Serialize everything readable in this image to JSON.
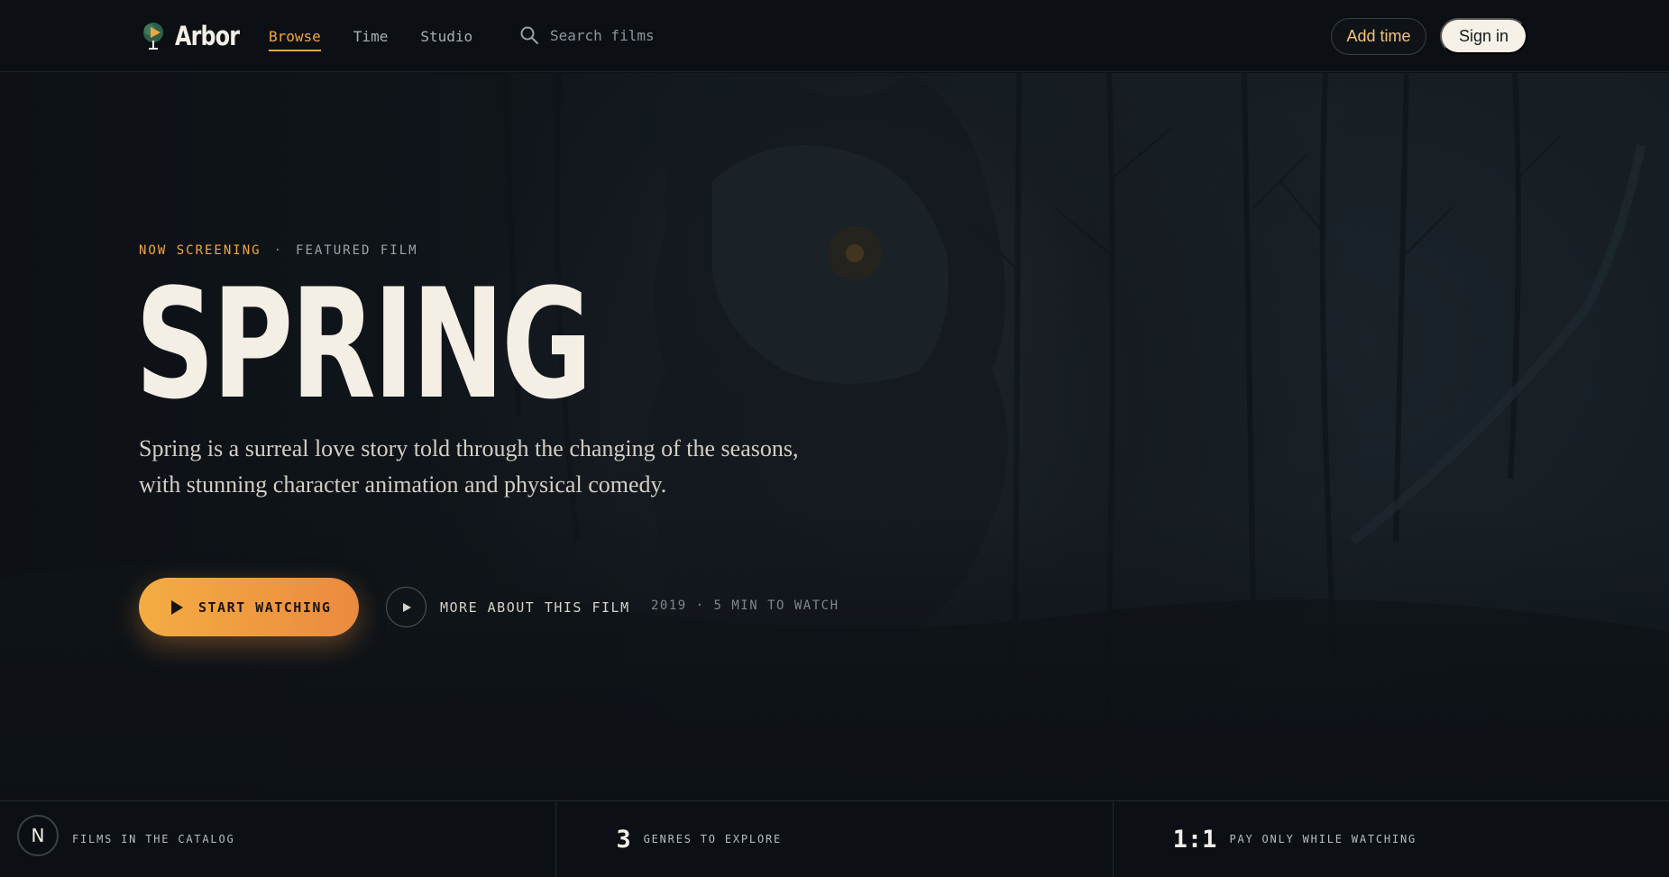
{
  "header": {
    "brand": "Arbor",
    "nav": [
      {
        "label": "Browse",
        "active": true
      },
      {
        "label": "Time",
        "active": false
      },
      {
        "label": "Studio",
        "active": false
      }
    ],
    "search_placeholder": "Search films",
    "add_time_label": "Add time",
    "sign_in_label": "Sign in"
  },
  "hero": {
    "eyebrow_accent": "NOW SCREENING",
    "eyebrow_separator": "·",
    "eyebrow_muted": "FEATURED FILM",
    "title": "SPRING",
    "description": "Spring is a surreal love story told through the changing of the seasons, with stunning character animation and physical comedy.",
    "primary_cta": "START WATCHING",
    "secondary_cta": "MORE ABOUT THIS FILM",
    "meta": "2019 · 5 MIN TO WATCH"
  },
  "stats": [
    {
      "number": "",
      "label": "FILMS IN THE CATALOG"
    },
    {
      "number": "3",
      "label": "GENRES TO EXPLORE"
    },
    {
      "number": "1:1",
      "label": "PAY ONLY WHILE WATCHING"
    }
  ],
  "badge": "N",
  "colors": {
    "accent": "#f2a642",
    "accent_gradient_end": "#ea8a3f",
    "background": "#0d1116",
    "text": "#f3efe6"
  },
  "icons": [
    "arbor-logo-icon",
    "search-icon",
    "play-icon",
    "play-circle-icon"
  ]
}
